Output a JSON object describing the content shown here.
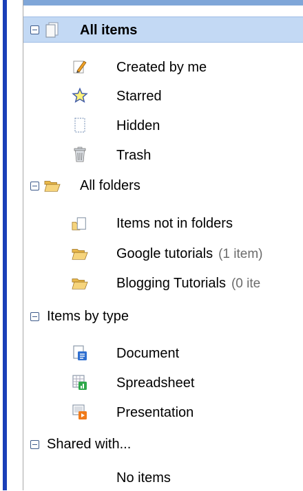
{
  "header": {
    "label": "All items"
  },
  "items": {
    "created_by_me": "Created by me",
    "starred": "Starred",
    "hidden": "Hidden",
    "trash": "Trash"
  },
  "folders": {
    "label": "All folders",
    "items_not_in_folders": "Items not in folders",
    "google_tutorials": {
      "label": "Google tutorials",
      "count": "(1 item)"
    },
    "blogging_tutorials": {
      "label": "Blogging Tutorials",
      "count": "(0 ite"
    }
  },
  "by_type": {
    "label": "Items by type",
    "document": "Document",
    "spreadsheet": "Spreadsheet",
    "presentation": "Presentation"
  },
  "shared": {
    "label": "Shared with...",
    "empty": "No items"
  },
  "colors": {
    "selected_bg": "#c3d9f4",
    "accent_bar": "#1a3fb8",
    "count_text": "#6b6b6b"
  },
  "icons": [
    "collapse-icon",
    "all-items-page-icon",
    "pencil-icon",
    "star-icon",
    "hidden-page-icon",
    "trash-icon",
    "folder-open-icon",
    "items-not-in-folders-icon",
    "document-icon",
    "spreadsheet-icon",
    "presentation-icon"
  ]
}
